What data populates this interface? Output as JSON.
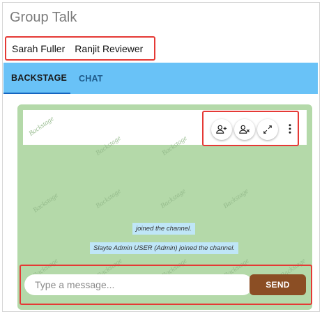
{
  "app": {
    "title": "Group Talk"
  },
  "participants": [
    "Sarah Fuller",
    "Ranjit Reviewer"
  ],
  "tabs": [
    {
      "label": "BACKSTAGE",
      "active": true
    },
    {
      "label": "CHAT",
      "active": false
    }
  ],
  "chat": {
    "watermark": "Backstage",
    "messages": [
      "joined the channel.",
      "Slayte Admin USER (Admin) joined the channel."
    ]
  },
  "video_controls": [
    {
      "icon": "add-person-icon"
    },
    {
      "icon": "remove-person-icon"
    },
    {
      "icon": "expand-icon"
    },
    {
      "icon": "more-vert-icon"
    }
  ],
  "composer": {
    "placeholder": "Type a message...",
    "send_label": "SEND"
  },
  "colors": {
    "tabbar": "#69c2f7",
    "chat_background": "#b4d9a9",
    "send_button": "#8b4e24",
    "system_message": "#bfe6f7",
    "highlight_border": "#e53935"
  }
}
